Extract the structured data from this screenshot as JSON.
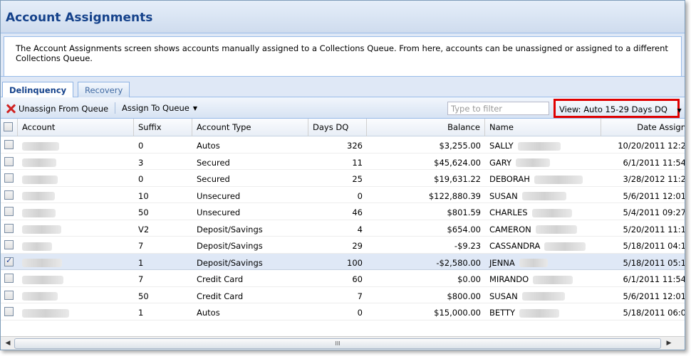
{
  "title": "Account Assignments",
  "description": "The Account Assignments screen shows accounts manually assigned to a Collections Queue. From here, accounts can be unassigned or assigned to a different Collections Queue.",
  "tabs": [
    {
      "label": "Delinquency",
      "active": true
    },
    {
      "label": "Recovery",
      "active": false
    }
  ],
  "toolbar": {
    "unassign_label": "Unassign From Queue",
    "assign_label": "Assign To Queue",
    "filter_placeholder": "Type to filter",
    "view_label": "View: Auto 15-29 Days DQ"
  },
  "columns": {
    "account": "Account",
    "suffix": "Suffix",
    "account_type": "Account Type",
    "days_dq": "Days DQ",
    "balance": "Balance",
    "name": "Name",
    "date_assigned": "Date Assign"
  },
  "rows": [
    {
      "suffix": "0",
      "type": "Autos",
      "days": "326",
      "balance": "$3,255.00",
      "name": "SALLY",
      "date": "10/20/2011 12:2",
      "checked": false
    },
    {
      "suffix": "3",
      "type": "Secured",
      "days": "11",
      "balance": "$45,624.00",
      "name": "GARY",
      "date": "6/1/2011 11:54",
      "checked": false
    },
    {
      "suffix": "0",
      "type": "Secured",
      "days": "25",
      "balance": "$19,631.22",
      "name": "DEBORAH",
      "date": "3/28/2012 11:2",
      "checked": false
    },
    {
      "suffix": "10",
      "type": "Unsecured",
      "days": "0",
      "balance": "$122,880.39",
      "name": "SUSAN",
      "date": "5/6/2011 12:01",
      "checked": false
    },
    {
      "suffix": "50",
      "type": "Unsecured",
      "days": "46",
      "balance": "$801.59",
      "name": "CHARLES",
      "date": "5/4/2011 09:27",
      "checked": false
    },
    {
      "suffix": "V2",
      "type": "Deposit/Savings",
      "days": "4",
      "balance": "$654.00",
      "name": "CAMERON",
      "date": "5/20/2011 11:1",
      "checked": false
    },
    {
      "suffix": "7",
      "type": "Deposit/Savings",
      "days": "29",
      "balance": "-$9.23",
      "name": "CASSANDRA",
      "date": "5/18/2011 04:1",
      "checked": false
    },
    {
      "suffix": "1",
      "type": "Deposit/Savings",
      "days": "100",
      "balance": "-$2,580.00",
      "name": "JENNA",
      "date": "5/18/2011 05:1",
      "checked": true
    },
    {
      "suffix": "7",
      "type": "Credit Card",
      "days": "60",
      "balance": "$0.00",
      "name": "MIRANDO",
      "date": "6/1/2011 11:54",
      "checked": false
    },
    {
      "suffix": "50",
      "type": "Credit Card",
      "days": "7",
      "balance": "$800.00",
      "name": "SUSAN",
      "date": "5/6/2011 12:01",
      "checked": false
    },
    {
      "suffix": "1",
      "type": "Autos",
      "days": "0",
      "balance": "$15,000.00",
      "name": "BETTY",
      "date": "5/18/2011 06:0",
      "checked": false
    }
  ],
  "scrollbar_grip": "III",
  "colors": {
    "header_text": "#15428b",
    "highlight_border": "#e00000",
    "selected_row": "#dfe8f6"
  }
}
